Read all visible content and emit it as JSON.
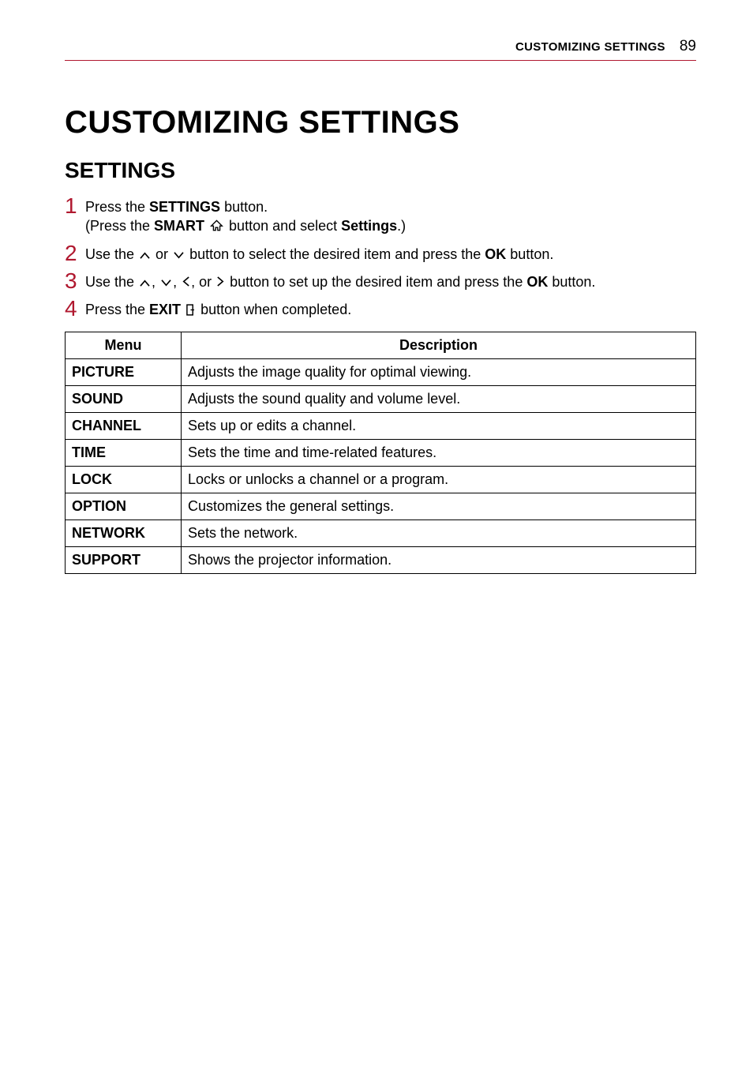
{
  "header": {
    "section_title": "CUSTOMIZING SETTINGS",
    "page_number": "89"
  },
  "title": "CUSTOMIZING SETTINGS",
  "subtitle": "SETTINGS",
  "steps": [
    {
      "n": "1",
      "pre": "Press the ",
      "bold1": "SETTINGS",
      "post1": " button.",
      "sub_pre": "(Press the ",
      "sub_bold": "SMART",
      "sub_mid": " ",
      "sub_after_icon": " button and select ",
      "sub_bold2": "Settings",
      "sub_post": ".)"
    },
    {
      "n": "2",
      "pre": "Use the ",
      "mid1": " or ",
      "post1": " button to select the desired item and press the ",
      "bold1": "OK",
      "post2": " button."
    },
    {
      "n": "3",
      "pre": "Use the ",
      "c1": ", ",
      "c2": ", ",
      "c3": ", or ",
      "post1": " button to set up the desired item and press the ",
      "bold1": "OK",
      "post2": " button."
    },
    {
      "n": "4",
      "pre": "Press the ",
      "bold1": "EXIT",
      "mid": " ",
      "post1": " button when completed."
    }
  ],
  "table": {
    "headers": {
      "menu": "Menu",
      "desc": "Description"
    },
    "rows": [
      {
        "menu": "PICTURE",
        "desc": "Adjusts the image quality for optimal viewing."
      },
      {
        "menu": "SOUND",
        "desc": "Adjusts the sound quality and volume level."
      },
      {
        "menu": "CHANNEL",
        "desc": "Sets up or edits a channel."
      },
      {
        "menu": "TIME",
        "desc": "Sets the time and time-related features."
      },
      {
        "menu": "LOCK",
        "desc": "Locks or unlocks a channel or a program."
      },
      {
        "menu": "OPTION",
        "desc": "Customizes the general settings."
      },
      {
        "menu": "NETWORK",
        "desc": "Sets the network."
      },
      {
        "menu": "SUPPORT",
        "desc": "Shows the projector information."
      }
    ]
  }
}
